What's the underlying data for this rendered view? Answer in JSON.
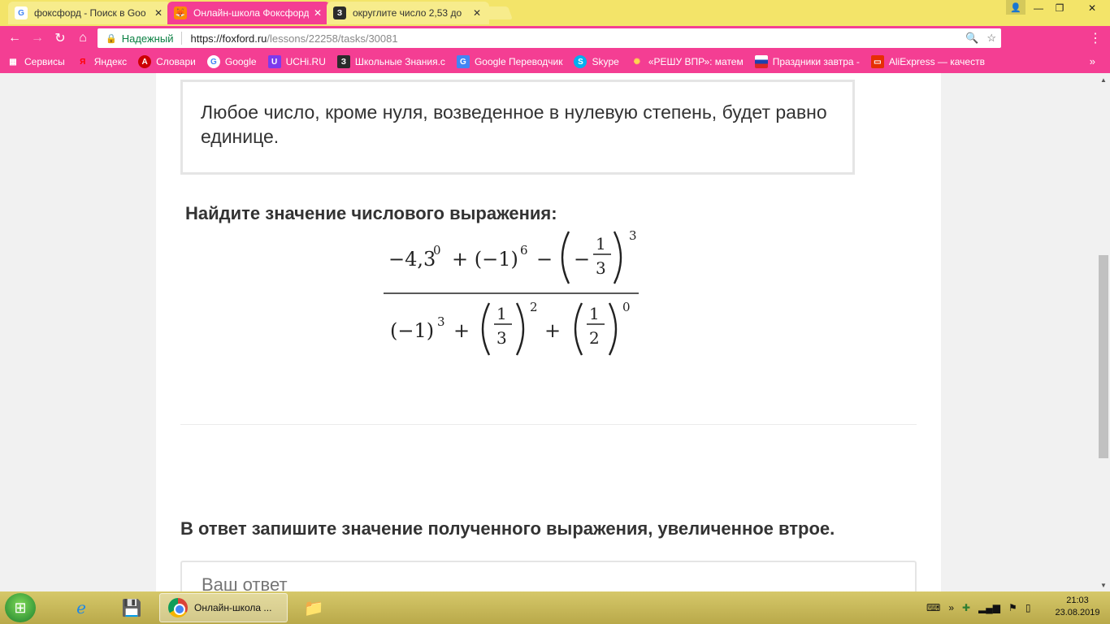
{
  "tabs": [
    {
      "title": "фоксфорд - Поиск в Goo",
      "icon": "google-icon"
    },
    {
      "title": "Онлайн-школа Фоксфорд",
      "icon": "foxford-icon"
    },
    {
      "title": "округлите число 2,53 до",
      "icon": "znania-icon",
      "icon_text": "З"
    }
  ],
  "tab_close": "✕",
  "window": {
    "minimize": "—",
    "maximize": "❐",
    "close": "✕"
  },
  "omnibox": {
    "secure_label": "Надежный",
    "url_host": "https://foxford.ru",
    "url_path": "/lessons/22258/tasks/30081"
  },
  "bookmarks": [
    {
      "label": "Сервисы",
      "icon": "apps-grid-icon"
    },
    {
      "label": "Яндекс",
      "icon": "yandex-icon"
    },
    {
      "label": "Словари",
      "icon": "dictionary-icon"
    },
    {
      "label": "Google",
      "icon": "google-icon"
    },
    {
      "label": "UCHi.RU",
      "icon": "uchi-icon"
    },
    {
      "label": "Школьные Знания.c",
      "icon": "znania-icon"
    },
    {
      "label": "Google Переводчик",
      "icon": "translate-icon"
    },
    {
      "label": "Skype",
      "icon": "skype-icon"
    },
    {
      "label": "«РЕШУ ВПР»: матем",
      "icon": "reshu-icon"
    },
    {
      "label": "Праздники завтра -",
      "icon": "flag-ru-icon"
    },
    {
      "label": "AliExpress — качеств",
      "icon": "aliexpress-icon"
    }
  ],
  "bookmarks_more": "»",
  "page": {
    "rule_text": "Любое число, кроме нуля, возведенное в нулевую степень, будет равно единице.",
    "task_title": "Найдите значение числового выражения:",
    "formula": {
      "numerator": [
        "−4,3",
        "0",
        "+ (−1)",
        "6",
        "−",
        "−",
        "1",
        "3",
        "3"
      ],
      "denominator": [
        "(−1)",
        "3",
        "+",
        "1",
        "3",
        "2",
        "+",
        "1",
        "2",
        "0"
      ]
    },
    "answer_title": "В ответ запишите значение полученного выражения, увеличенное втрое.",
    "answer_placeholder": "Ваш ответ"
  },
  "taskbar": {
    "active_task": "Онлайн-школа ...",
    "time": "21:03",
    "date": "23.08.2019"
  },
  "colors": {
    "chrome_theme": "#f43e93",
    "tabstrip": "#f3e469"
  }
}
